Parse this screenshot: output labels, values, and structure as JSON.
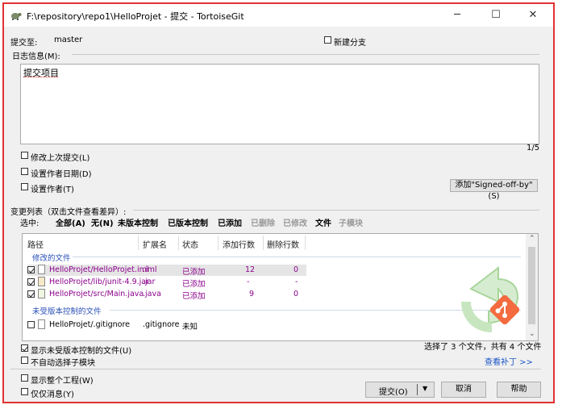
{
  "window": {
    "title": "F:\\repository\\repo1\\HelloProjet - 提交 - TortoiseGit",
    "minimize": "─",
    "maximize": "☐",
    "close": "✕",
    "app_icon": "tortoisegit-icon"
  },
  "commit_to": {
    "label": "提交至:",
    "branch": "master",
    "new_branch_label": "新建分支",
    "new_branch_checked": false
  },
  "log_message": {
    "label": "日志信息(M):",
    "text": "提交项目",
    "line_counter": "1/5"
  },
  "options": {
    "amend_label": "修改上次提交(L)",
    "set_date_label": "设置作者日期(D)",
    "set_author_label": "设置作者(T)",
    "signed_off_button": "添加\"Signed-off-by\"(S)"
  },
  "changes": {
    "label": "变更列表（双击文件查看差异）:",
    "select_label": "选中:",
    "select_links": [
      {
        "label": "全部(A)",
        "enabled": true
      },
      {
        "label": "无(N)",
        "enabled": true
      },
      {
        "label": "未版本控制",
        "enabled": true
      },
      {
        "label": "已版本控制",
        "enabled": true
      },
      {
        "label": "已添加",
        "enabled": true
      },
      {
        "label": "已删除",
        "enabled": false
      },
      {
        "label": "已修改",
        "enabled": false
      },
      {
        "label": "文件",
        "enabled": true
      },
      {
        "label": "子模块",
        "enabled": false
      }
    ],
    "columns": [
      "路径",
      "扩展名",
      "状态",
      "添加行数",
      "删除行数"
    ],
    "group_modified": "修改的文件",
    "group_unversioned": "未受版本控制的文件",
    "files": [
      {
        "path": "HelloProjet/HelloProjet.iml",
        "ext": ".iml",
        "status": "已添加",
        "added": "12",
        "deleted": "0",
        "checked": true,
        "selected": true
      },
      {
        "path": "HelloProjet/lib/junit-4.9.jar",
        "ext": ".jar",
        "status": "已添加",
        "added": "-",
        "deleted": "-",
        "checked": true,
        "selected": false
      },
      {
        "path": "HelloProjet/src/Main.java",
        "ext": ".java",
        "status": "已添加",
        "added": "9",
        "deleted": "0",
        "checked": true,
        "selected": false
      }
    ],
    "unversioned_files": [
      {
        "path": "HelloProjet/.gitignore",
        "ext": ".gitignore",
        "status": "未知",
        "checked": false
      }
    ],
    "summary": "选择了 3 个文件，共有 4 个文件",
    "view_patch": "查看补丁 >>"
  },
  "bottom_options": {
    "show_unversioned": "显示未受版本控制的文件(U)",
    "show_unversioned_checked": true,
    "no_auto_submodule": "不自动选择子模块",
    "show_whole_project": "显示整个工程(W)",
    "message_only": "仅仅消息(Y)"
  },
  "buttons": {
    "commit": "提交(O)",
    "cancel": "取消",
    "help": "帮助"
  },
  "colors": {
    "frame_border": "#e23131",
    "added_status": "#8b008b",
    "group_label": "#2a4fb6",
    "link": "#1a55c8"
  }
}
